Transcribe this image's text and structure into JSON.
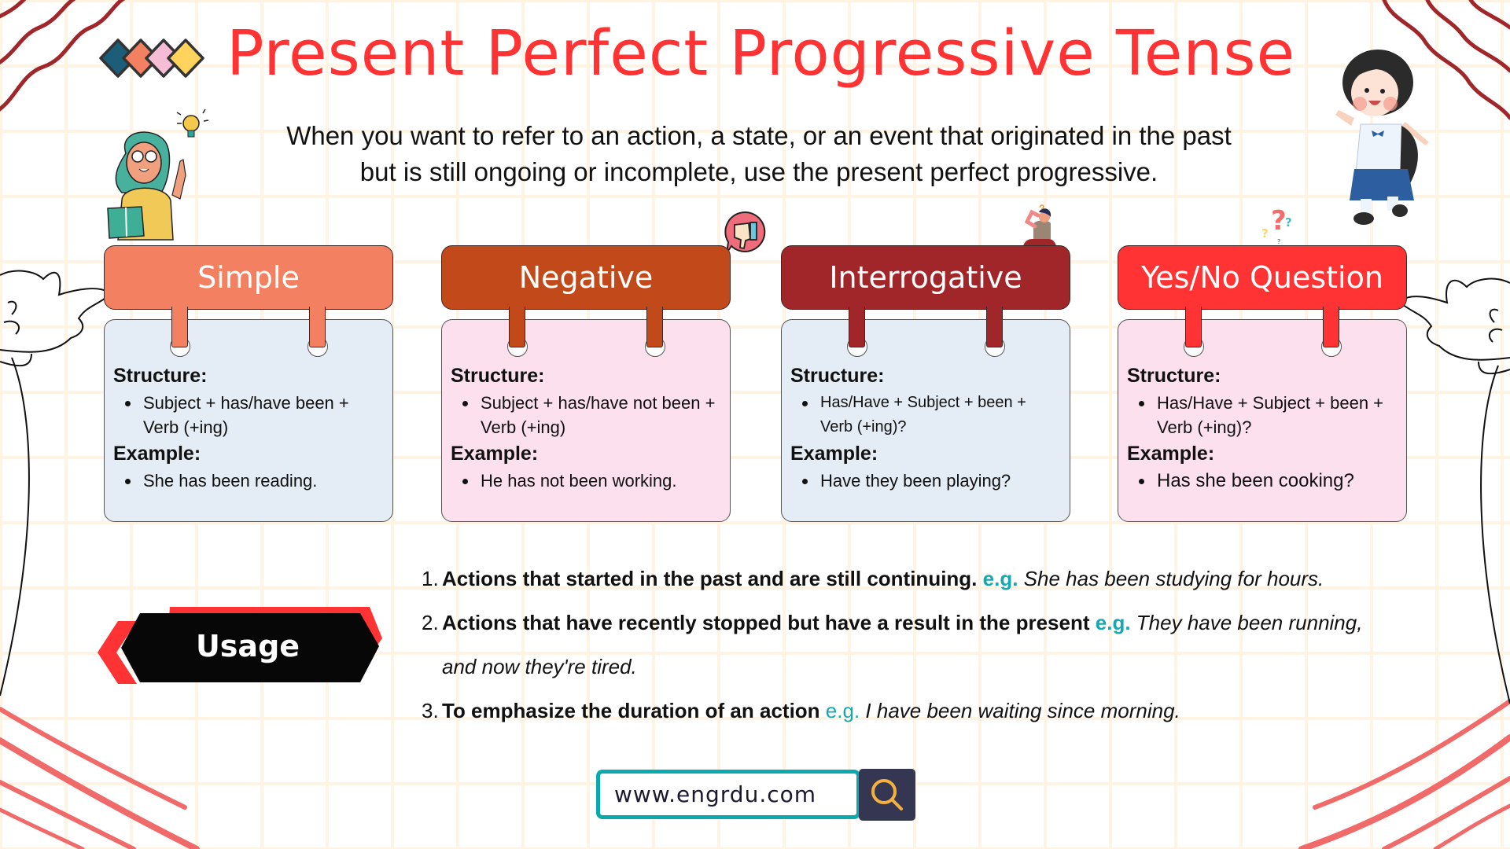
{
  "title": "Present Perfect Progressive Tense",
  "intro": {
    "line1": "When you want to refer to an action, a state, or an event that originated in the past",
    "line2": "but is still ongoing or incomplete, use the present perfect progressive."
  },
  "colors": {
    "title": "#ff3333",
    "simple": "#f38060",
    "negative": "#c24a1a",
    "interrogative": "#a0262a",
    "yesno": "#ff3333",
    "body_blue": "#e4ecf5",
    "body_pink": "#fde0ee",
    "accent_teal": "#16a8b0",
    "diamonds": [
      "#1c5e78",
      "#f38060",
      "#f6bcd6",
      "#ffd35c"
    ]
  },
  "cards": [
    {
      "header": "Simple",
      "structure_label": "Structure:",
      "structure": "Subject + has/have been + Verb (+ing)",
      "example_label": "Example:",
      "example": "She has been reading."
    },
    {
      "header": "Negative",
      "structure_label": "Structure:",
      "structure": "Subject + has/have not been + Verb (+ing)",
      "example_label": "Example:",
      "example": "He has not been working."
    },
    {
      "header": "Interrogative",
      "structure_label": "Structure:",
      "structure": "Has/Have + Subject + been + Verb (+ing)?",
      "example_label": "Example:",
      "example": "Have they been playing?"
    },
    {
      "header": "Yes/No Question",
      "structure_label": "Structure:",
      "structure": "Has/Have + Subject + been + Verb (+ing)?",
      "example_label": "Example:",
      "example": "Has she been cooking?"
    }
  ],
  "usage": {
    "label": "Usage",
    "items": [
      {
        "num": "1.",
        "rule": "Actions that started in the past and are still continuing.",
        "eg": "e.g.",
        "example": "She has been studying for hours."
      },
      {
        "num": "2.",
        "rule": "Actions that have recently stopped but have a result in the present",
        "eg": "e.g.",
        "example": "They have been running,",
        "example_cont": "and now they're tired."
      },
      {
        "num": "3.",
        "rule": "To emphasize the duration of an action",
        "eg": "e.g.",
        "example": "I have been waiting since morning."
      }
    ]
  },
  "website": "www.engrdu.com",
  "icons": {
    "diamonds": "diamond-row-icon",
    "lightbulb": "lightbulb-icon",
    "thumbs_down": "thumbs-down-icon",
    "question_marks": "question-marks-icon",
    "search": "search-icon"
  }
}
